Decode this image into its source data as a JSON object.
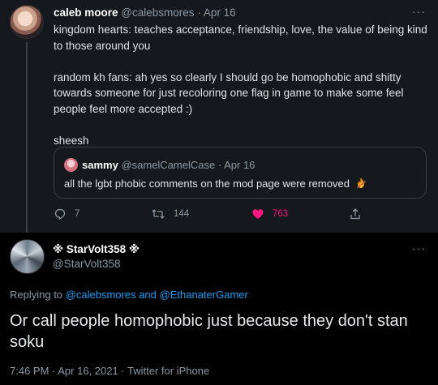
{
  "tweet1": {
    "display_name": "caleb moore",
    "handle": "@calebsmores",
    "separator": "·",
    "date": "Apr 16",
    "more": "···",
    "text": [
      "kingdom hearts: teaches acceptance, friendship, love, the value of being kind to those around you",
      "random kh fans: ah yes so clearly I should go be homophobic and shitty towards someone for just recoloring one flag in game to make some feel people feel more accepted :)",
      "sheesh"
    ],
    "quote": {
      "display_name": "sammy",
      "handle": "@samelCamelCase",
      "separator": "·",
      "date": "Apr 16",
      "text": "all the lgbt phobic comments on the mod page were removed",
      "emoji": "fire-icon"
    },
    "actions": {
      "replies": "7",
      "retweets": "144",
      "likes": "763"
    },
    "colors": {
      "like": "#f91880",
      "background": "#15181c"
    }
  },
  "tweet2": {
    "display_name": "※ StarVolt358 ※",
    "handle": "@StarVolt358",
    "more": "···",
    "replying_prefix": "Replying to",
    "replying_to_1": "@calebsmores",
    "replying_and": "and",
    "replying_to_2": "@EthanaterGamer",
    "text": "Or call people homophobic just because they don't stan soku",
    "timestamp": "7:46 PM · Apr 16, 2021 · Twitter for iPhone",
    "colors": {
      "link": "#1d9bf0",
      "background": "#000000"
    }
  }
}
